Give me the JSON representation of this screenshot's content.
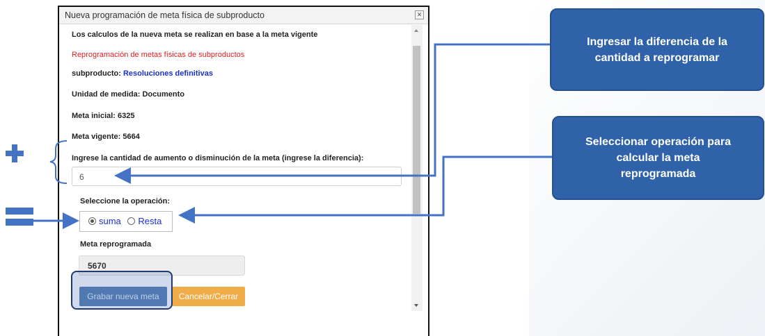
{
  "dialog": {
    "title": "Nueva programación de meta física de subproducto",
    "close_glyph": "✕",
    "intro": "Los calculos de la nueva meta se realizan en base a la meta vigente",
    "section_title": "Reprogramación de metas físicas de subproductos",
    "subproducto_label": "subproducto:",
    "subproducto_value": "Resoluciones definitivas",
    "unidad": "Unidad de medida: Documento",
    "meta_inicial": "Meta inicial: 6325",
    "meta_vigente": "Meta vigente: 5664",
    "diferencia_label": "Ingrese la cantidad de aumento o disminución de la meta (ingrese la diferencia):",
    "diferencia_value": "6",
    "operacion_label": "Seleccione la operación:",
    "options": [
      "suma",
      "Resta"
    ],
    "selected_option": "suma",
    "meta_reprog_label": "Meta reprogramada",
    "meta_reprog_value": "5670",
    "save_label": "Grabar nueva meta",
    "cancel_label": "Cancelar/Cerrar"
  },
  "callouts": {
    "diferencia": "Ingresar la diferencia de la cantidad a reprogramar",
    "operacion": "Seleccionar operación para calcular la meta reprogramada"
  },
  "colors": {
    "callout": "#2f62a8",
    "arrow": "#4472c4",
    "save_button": "#3b6aa6",
    "cancel_button": "#f0ac49",
    "section_title": "#e02020",
    "link_blue": "#1a2fd0"
  }
}
